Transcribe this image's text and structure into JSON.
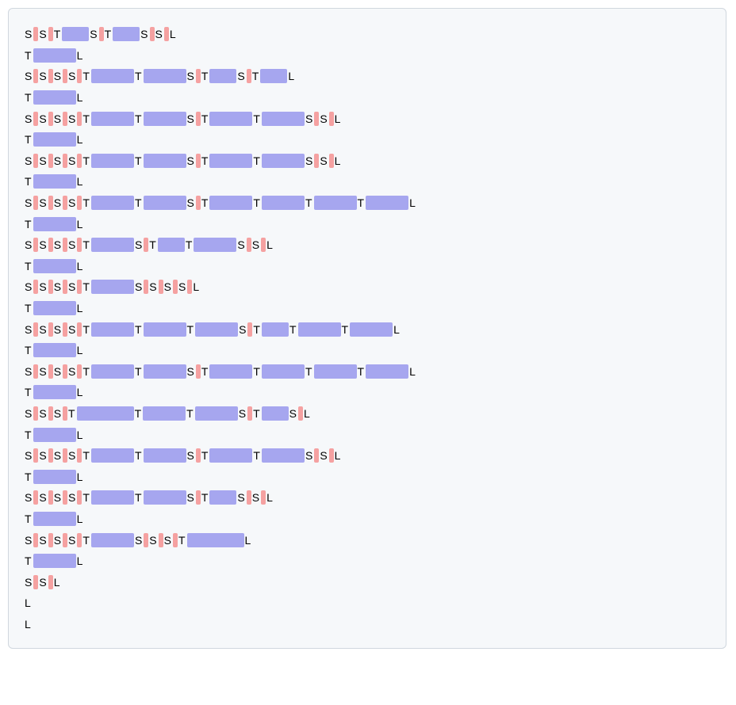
{
  "token_labels": {
    "S": "S",
    "T": "T",
    "L": "L"
  },
  "colors": {
    "pink": "#f5a1a1",
    "purple": "#a6a6ef"
  },
  "widths": {
    "s": 6,
    "t_short": 34,
    "t_med": 54,
    "t_long": 72
  },
  "lines": [
    [
      {
        "k": "S"
      },
      {
        "k": "s"
      },
      {
        "k": "S"
      },
      {
        "k": "s"
      },
      {
        "k": "T"
      },
      {
        "k": "t",
        "w": "t_short"
      },
      {
        "k": "S"
      },
      {
        "k": "s"
      },
      {
        "k": "T"
      },
      {
        "k": "t",
        "w": "t_short"
      },
      {
        "k": "S"
      },
      {
        "k": "s"
      },
      {
        "k": "S"
      },
      {
        "k": "s"
      },
      {
        "k": "L"
      }
    ],
    [
      {
        "k": "T"
      },
      {
        "k": "t",
        "w": "t_med"
      },
      {
        "k": "L"
      }
    ],
    [
      {
        "k": "S"
      },
      {
        "k": "s"
      },
      {
        "k": "S"
      },
      {
        "k": "s"
      },
      {
        "k": "S"
      },
      {
        "k": "s"
      },
      {
        "k": "S"
      },
      {
        "k": "s"
      },
      {
        "k": "T"
      },
      {
        "k": "t",
        "w": "t_med"
      },
      {
        "k": "T"
      },
      {
        "k": "t",
        "w": "t_med"
      },
      {
        "k": "S"
      },
      {
        "k": "s"
      },
      {
        "k": "T"
      },
      {
        "k": "t",
        "w": "t_short"
      },
      {
        "k": "S"
      },
      {
        "k": "s"
      },
      {
        "k": "T"
      },
      {
        "k": "t",
        "w": "t_short"
      },
      {
        "k": "L"
      }
    ],
    [
      {
        "k": "T"
      },
      {
        "k": "t",
        "w": "t_med"
      },
      {
        "k": "L"
      }
    ],
    [
      {
        "k": "S"
      },
      {
        "k": "s"
      },
      {
        "k": "S"
      },
      {
        "k": "s"
      },
      {
        "k": "S"
      },
      {
        "k": "s"
      },
      {
        "k": "S"
      },
      {
        "k": "s"
      },
      {
        "k": "T"
      },
      {
        "k": "t",
        "w": "t_med"
      },
      {
        "k": "T"
      },
      {
        "k": "t",
        "w": "t_med"
      },
      {
        "k": "S"
      },
      {
        "k": "s"
      },
      {
        "k": "T"
      },
      {
        "k": "t",
        "w": "t_med"
      },
      {
        "k": "T"
      },
      {
        "k": "t",
        "w": "t_med"
      },
      {
        "k": "S"
      },
      {
        "k": "s"
      },
      {
        "k": "S"
      },
      {
        "k": "s"
      },
      {
        "k": "L"
      }
    ],
    [
      {
        "k": "T"
      },
      {
        "k": "t",
        "w": "t_med"
      },
      {
        "k": "L"
      }
    ],
    [
      {
        "k": "S"
      },
      {
        "k": "s"
      },
      {
        "k": "S"
      },
      {
        "k": "s"
      },
      {
        "k": "S"
      },
      {
        "k": "s"
      },
      {
        "k": "S"
      },
      {
        "k": "s"
      },
      {
        "k": "T"
      },
      {
        "k": "t",
        "w": "t_med"
      },
      {
        "k": "T"
      },
      {
        "k": "t",
        "w": "t_med"
      },
      {
        "k": "S"
      },
      {
        "k": "s"
      },
      {
        "k": "T"
      },
      {
        "k": "t",
        "w": "t_med"
      },
      {
        "k": "T"
      },
      {
        "k": "t",
        "w": "t_med"
      },
      {
        "k": "S"
      },
      {
        "k": "s"
      },
      {
        "k": "S"
      },
      {
        "k": "s"
      },
      {
        "k": "L"
      }
    ],
    [
      {
        "k": "T"
      },
      {
        "k": "t",
        "w": "t_med"
      },
      {
        "k": "L"
      }
    ],
    [
      {
        "k": "S"
      },
      {
        "k": "s"
      },
      {
        "k": "S"
      },
      {
        "k": "s"
      },
      {
        "k": "S"
      },
      {
        "k": "s"
      },
      {
        "k": "S"
      },
      {
        "k": "s"
      },
      {
        "k": "T"
      },
      {
        "k": "t",
        "w": "t_med"
      },
      {
        "k": "T"
      },
      {
        "k": "t",
        "w": "t_med"
      },
      {
        "k": "S"
      },
      {
        "k": "s"
      },
      {
        "k": "T"
      },
      {
        "k": "t",
        "w": "t_med"
      },
      {
        "k": "T"
      },
      {
        "k": "t",
        "w": "t_med"
      },
      {
        "k": "T"
      },
      {
        "k": "t",
        "w": "t_med"
      },
      {
        "k": "T"
      },
      {
        "k": "t",
        "w": "t_med"
      },
      {
        "k": "L"
      }
    ],
    [
      {
        "k": "T"
      },
      {
        "k": "t",
        "w": "t_med"
      },
      {
        "k": "L"
      }
    ],
    [
      {
        "k": "S"
      },
      {
        "k": "s"
      },
      {
        "k": "S"
      },
      {
        "k": "s"
      },
      {
        "k": "S"
      },
      {
        "k": "s"
      },
      {
        "k": "S"
      },
      {
        "k": "s"
      },
      {
        "k": "T"
      },
      {
        "k": "t",
        "w": "t_med"
      },
      {
        "k": "S"
      },
      {
        "k": "s"
      },
      {
        "k": "T"
      },
      {
        "k": "t",
        "w": "t_short"
      },
      {
        "k": "T"
      },
      {
        "k": "t",
        "w": "t_med"
      },
      {
        "k": "S"
      },
      {
        "k": "s"
      },
      {
        "k": "S"
      },
      {
        "k": "s"
      },
      {
        "k": "L"
      }
    ],
    [
      {
        "k": "T"
      },
      {
        "k": "t",
        "w": "t_med"
      },
      {
        "k": "L"
      }
    ],
    [
      {
        "k": "S"
      },
      {
        "k": "s"
      },
      {
        "k": "S"
      },
      {
        "k": "s"
      },
      {
        "k": "S"
      },
      {
        "k": "s"
      },
      {
        "k": "S"
      },
      {
        "k": "s"
      },
      {
        "k": "T"
      },
      {
        "k": "t",
        "w": "t_med"
      },
      {
        "k": "S"
      },
      {
        "k": "s"
      },
      {
        "k": "S"
      },
      {
        "k": "s"
      },
      {
        "k": "S"
      },
      {
        "k": "s"
      },
      {
        "k": "S"
      },
      {
        "k": "s"
      },
      {
        "k": "L"
      }
    ],
    [
      {
        "k": "T"
      },
      {
        "k": "t",
        "w": "t_med"
      },
      {
        "k": "L"
      }
    ],
    [
      {
        "k": "S"
      },
      {
        "k": "s"
      },
      {
        "k": "S"
      },
      {
        "k": "s"
      },
      {
        "k": "S"
      },
      {
        "k": "s"
      },
      {
        "k": "S"
      },
      {
        "k": "s"
      },
      {
        "k": "T"
      },
      {
        "k": "t",
        "w": "t_med"
      },
      {
        "k": "T"
      },
      {
        "k": "t",
        "w": "t_med"
      },
      {
        "k": "T"
      },
      {
        "k": "t",
        "w": "t_med"
      },
      {
        "k": "S"
      },
      {
        "k": "s"
      },
      {
        "k": "T"
      },
      {
        "k": "t",
        "w": "t_short"
      },
      {
        "k": "T"
      },
      {
        "k": "t",
        "w": "t_med"
      },
      {
        "k": "T"
      },
      {
        "k": "t",
        "w": "t_med"
      },
      {
        "k": "L"
      }
    ],
    [
      {
        "k": "T"
      },
      {
        "k": "t",
        "w": "t_med"
      },
      {
        "k": "L"
      }
    ],
    [
      {
        "k": "S"
      },
      {
        "k": "s"
      },
      {
        "k": "S"
      },
      {
        "k": "s"
      },
      {
        "k": "S"
      },
      {
        "k": "s"
      },
      {
        "k": "S"
      },
      {
        "k": "s"
      },
      {
        "k": "T"
      },
      {
        "k": "t",
        "w": "t_med"
      },
      {
        "k": "T"
      },
      {
        "k": "t",
        "w": "t_med"
      },
      {
        "k": "S"
      },
      {
        "k": "s"
      },
      {
        "k": "T"
      },
      {
        "k": "t",
        "w": "t_med"
      },
      {
        "k": "T"
      },
      {
        "k": "t",
        "w": "t_med"
      },
      {
        "k": "T"
      },
      {
        "k": "t",
        "w": "t_med"
      },
      {
        "k": "T"
      },
      {
        "k": "t",
        "w": "t_med"
      },
      {
        "k": "L"
      }
    ],
    [
      {
        "k": "T"
      },
      {
        "k": "t",
        "w": "t_med"
      },
      {
        "k": "L"
      }
    ],
    [
      {
        "k": "S"
      },
      {
        "k": "s"
      },
      {
        "k": "S"
      },
      {
        "k": "s"
      },
      {
        "k": "S"
      },
      {
        "k": "s"
      },
      {
        "k": "T"
      },
      {
        "k": "t",
        "w": "t_long"
      },
      {
        "k": "T"
      },
      {
        "k": "t",
        "w": "t_med"
      },
      {
        "k": "T"
      },
      {
        "k": "t",
        "w": "t_med"
      },
      {
        "k": "S"
      },
      {
        "k": "s"
      },
      {
        "k": "T"
      },
      {
        "k": "t",
        "w": "t_short"
      },
      {
        "k": "S"
      },
      {
        "k": "s"
      },
      {
        "k": "L"
      }
    ],
    [
      {
        "k": "T"
      },
      {
        "k": "t",
        "w": "t_med"
      },
      {
        "k": "L"
      }
    ],
    [
      {
        "k": "S"
      },
      {
        "k": "s"
      },
      {
        "k": "S"
      },
      {
        "k": "s"
      },
      {
        "k": "S"
      },
      {
        "k": "s"
      },
      {
        "k": "S"
      },
      {
        "k": "s"
      },
      {
        "k": "T"
      },
      {
        "k": "t",
        "w": "t_med"
      },
      {
        "k": "T"
      },
      {
        "k": "t",
        "w": "t_med"
      },
      {
        "k": "S"
      },
      {
        "k": "s"
      },
      {
        "k": "T"
      },
      {
        "k": "t",
        "w": "t_med"
      },
      {
        "k": "T"
      },
      {
        "k": "t",
        "w": "t_med"
      },
      {
        "k": "S"
      },
      {
        "k": "s"
      },
      {
        "k": "S"
      },
      {
        "k": "s"
      },
      {
        "k": "L"
      }
    ],
    [
      {
        "k": "T"
      },
      {
        "k": "t",
        "w": "t_med"
      },
      {
        "k": "L"
      }
    ],
    [
      {
        "k": "S"
      },
      {
        "k": "s"
      },
      {
        "k": "S"
      },
      {
        "k": "s"
      },
      {
        "k": "S"
      },
      {
        "k": "s"
      },
      {
        "k": "S"
      },
      {
        "k": "s"
      },
      {
        "k": "T"
      },
      {
        "k": "t",
        "w": "t_med"
      },
      {
        "k": "T"
      },
      {
        "k": "t",
        "w": "t_med"
      },
      {
        "k": "S"
      },
      {
        "k": "s"
      },
      {
        "k": "T"
      },
      {
        "k": "t",
        "w": "t_short"
      },
      {
        "k": "S"
      },
      {
        "k": "s"
      },
      {
        "k": "S"
      },
      {
        "k": "s"
      },
      {
        "k": "L"
      }
    ],
    [
      {
        "k": "T"
      },
      {
        "k": "t",
        "w": "t_med"
      },
      {
        "k": "L"
      }
    ],
    [
      {
        "k": "S"
      },
      {
        "k": "s"
      },
      {
        "k": "S"
      },
      {
        "k": "s"
      },
      {
        "k": "S"
      },
      {
        "k": "s"
      },
      {
        "k": "S"
      },
      {
        "k": "s"
      },
      {
        "k": "T"
      },
      {
        "k": "t",
        "w": "t_med"
      },
      {
        "k": "S"
      },
      {
        "k": "s"
      },
      {
        "k": "S"
      },
      {
        "k": "s"
      },
      {
        "k": "S"
      },
      {
        "k": "s"
      },
      {
        "k": "T"
      },
      {
        "k": "t",
        "w": "t_long"
      },
      {
        "k": "L"
      }
    ],
    [
      {
        "k": "T"
      },
      {
        "k": "t",
        "w": "t_med"
      },
      {
        "k": "L"
      }
    ],
    [
      {
        "k": "S"
      },
      {
        "k": "s"
      },
      {
        "k": "S"
      },
      {
        "k": "s"
      },
      {
        "k": "L"
      }
    ],
    [
      {
        "k": "L"
      }
    ],
    [
      {
        "k": "L"
      }
    ]
  ]
}
